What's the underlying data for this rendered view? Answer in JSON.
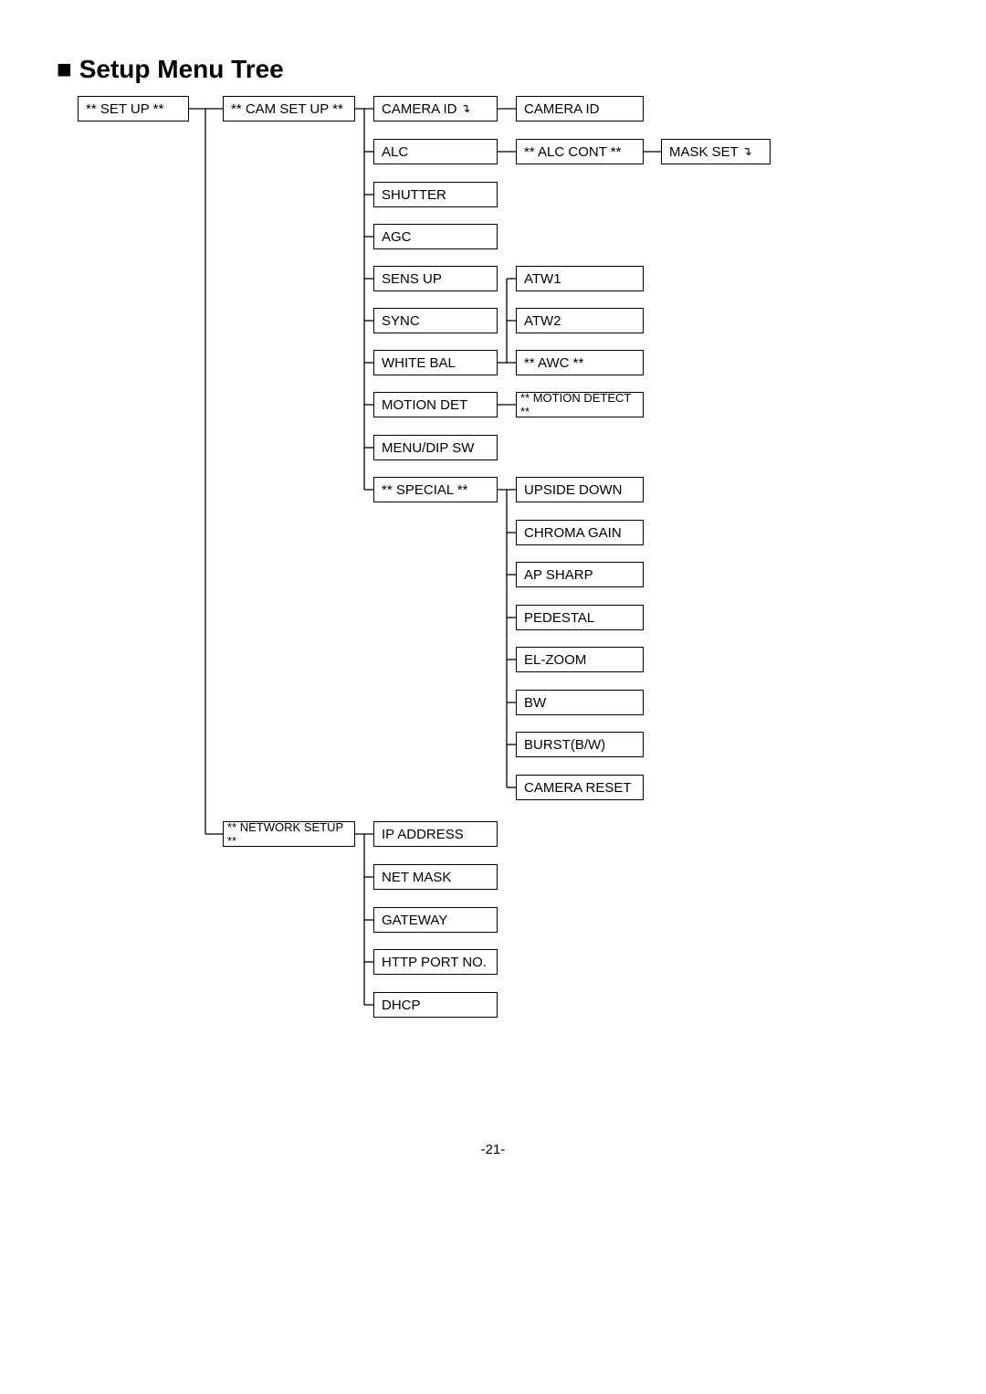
{
  "title_text": "Setup Menu Tree",
  "page_number": "-21-",
  "col0": {
    "setup": "** SET UP **"
  },
  "col1": {
    "camsetup": "** CAM  SET UP **",
    "netsetup": "** NETWORK SETUP **"
  },
  "col2": {
    "camera_id": "CAMERA ID",
    "alc": "ALC",
    "shutter": "SHUTTER",
    "agc": "AGC",
    "sensup": "SENS UP",
    "sync": "SYNC",
    "whitebal": "WHITE BAL",
    "motiondet": "MOTION DET",
    "menu_dip": "MENU/DIP SW",
    "special": "** SPECIAL **",
    "ip": "IP ADDRESS",
    "netmask": "NET MASK",
    "gateway": "GATEWAY",
    "http": "HTTP PORT NO.",
    "dhcp": "DHCP"
  },
  "col3": {
    "camera_id": "CAMERA ID",
    "alc_cont": "** ALC CONT **",
    "atw1": "ATW1",
    "atw2": "ATW2",
    "awc": "** AWC **",
    "motion_detect": "** MOTION DETECT **",
    "upside": "UPSIDE DOWN",
    "chroma": "CHROMA GAIN",
    "apsharp": "AP SHARP",
    "pedestal": "PEDESTAL",
    "elzoom": "EL-ZOOM",
    "bw": "BW",
    "burst": "BURST(B/W)",
    "camreset": "CAMERA RESET"
  },
  "col4": {
    "maskset": "MASK SET"
  },
  "submark": "↴"
}
